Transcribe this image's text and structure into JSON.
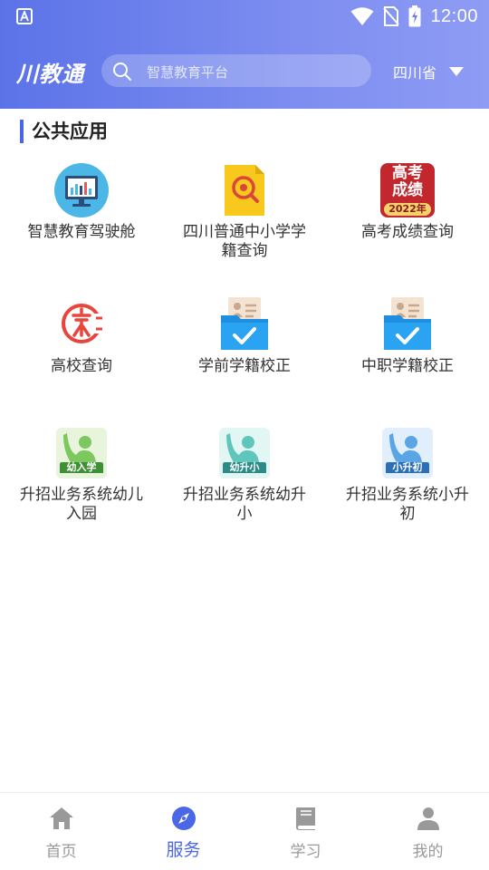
{
  "status": {
    "time": "12:00"
  },
  "header": {
    "logo": "川教通",
    "search_placeholder": "智慧教育平台",
    "region": "四川省"
  },
  "section": {
    "title": "公共应用"
  },
  "apps": [
    {
      "label": "智慧教育驾驶舱",
      "icon": "dashboard-monitor-icon"
    },
    {
      "label": "四川普通中小学学籍查询",
      "icon": "search-document-icon"
    },
    {
      "label": "高考成绩查询",
      "icon": "gaokao-score-icon",
      "badge_line1": "高考",
      "badge_line2": "成绩",
      "badge_year": "2022年"
    },
    {
      "label": "高校查询",
      "icon": "university-logo-icon"
    },
    {
      "label": "学前学籍校正",
      "icon": "folder-id-check-icon"
    },
    {
      "label": "中职学籍校正",
      "icon": "folder-id-check-icon"
    },
    {
      "label": "升招业务系统幼儿入园",
      "icon": "student-hand-raise-icon",
      "tag": "幼入学",
      "color": "#3f8f36"
    },
    {
      "label": "升招业务系统幼升小",
      "icon": "student-hand-raise-icon",
      "tag": "幼升小",
      "color": "#2e8a84"
    },
    {
      "label": "升招业务系统小升初",
      "icon": "student-hand-raise-icon",
      "tag": "小升初",
      "color": "#2d6fb4"
    }
  ],
  "nav": [
    {
      "label": "首页",
      "icon": "home-icon",
      "active": false
    },
    {
      "label": "服务",
      "icon": "compass-icon",
      "active": true
    },
    {
      "label": "学习",
      "icon": "book-icon",
      "active": false
    },
    {
      "label": "我的",
      "icon": "person-icon",
      "active": false
    }
  ],
  "colors": {
    "accent": "#4a67e6",
    "header_start": "#5b73e8",
    "header_end": "#8e9cf4"
  }
}
